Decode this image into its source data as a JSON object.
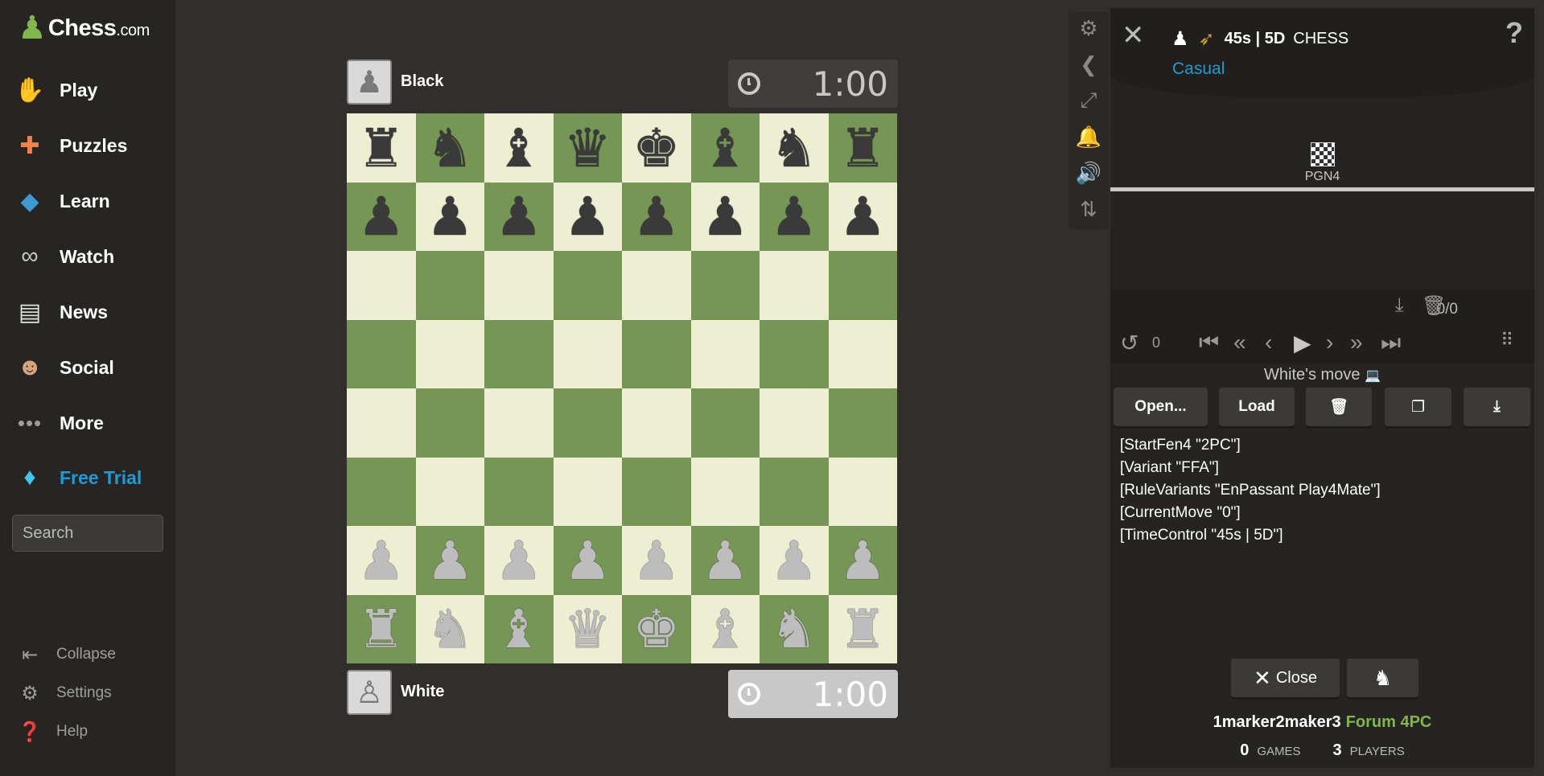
{
  "brand": {
    "word": "Chess",
    "suffix": ".com"
  },
  "sidebar": {
    "items": [
      {
        "label": "Play",
        "icon": "play-hand-icon"
      },
      {
        "label": "Puzzles",
        "icon": "puzzle-icon"
      },
      {
        "label": "Learn",
        "icon": "graduation-cap-icon"
      },
      {
        "label": "Watch",
        "icon": "binoculars-icon"
      },
      {
        "label": "News",
        "icon": "newspaper-icon"
      },
      {
        "label": "Social",
        "icon": "people-icon"
      },
      {
        "label": "More",
        "icon": "dots-icon"
      },
      {
        "label": "Free Trial",
        "icon": "diamond-icon"
      }
    ],
    "search_placeholder": "Search",
    "footer": [
      {
        "label": "Collapse",
        "icon": "collapse-icon"
      },
      {
        "label": "Settings",
        "icon": "gear-icon"
      },
      {
        "label": "Help",
        "icon": "help-icon"
      }
    ],
    "accent": "#1e9bd7"
  },
  "players": {
    "top": {
      "name": "Black",
      "clock": "1:00"
    },
    "bottom": {
      "name": "White",
      "clock": "1:00"
    }
  },
  "board": {
    "light_color": "#eeeed2",
    "dark_color": "#769656",
    "ranks": [
      [
        "bR",
        "bN",
        "bB",
        "bQ",
        "bK",
        "bB",
        "bN",
        "bR"
      ],
      [
        "bP",
        "bP",
        "bP",
        "bP",
        "bP",
        "bP",
        "bP",
        "bP"
      ],
      [
        "",
        "",
        "",
        "",
        "",
        "",
        "",
        ""
      ],
      [
        "",
        "",
        "",
        "",
        "",
        "",
        "",
        ""
      ],
      [
        "",
        "",
        "",
        "",
        "",
        "",
        "",
        ""
      ],
      [
        "",
        "",
        "",
        "",
        "",
        "",
        "",
        ""
      ],
      [
        "wP",
        "wP",
        "wP",
        "wP",
        "wP",
        "wP",
        "wP",
        "wP"
      ],
      [
        "wR",
        "wN",
        "wB",
        "wQ",
        "wK",
        "wB",
        "wN",
        "wR"
      ]
    ]
  },
  "panel": {
    "time_control": "45s | 5D",
    "variant_name": "CHESS",
    "rated": "Casual",
    "help": "?",
    "tab_label": "PGN4",
    "move_counter": "0/0",
    "undo_count": "0",
    "turn_text": "White's move",
    "buttons": {
      "open": "Open...",
      "load": "Load"
    },
    "pgn_lines": [
      "[StartFen4 \"2PC\"]",
      "[Variant \"FFA\"]",
      "[RuleVariants \"EnPassant Play4Mate\"]",
      "[CurrentMove \"0\"]",
      "[TimeControl \"45s | 5D\"]"
    ],
    "close_label": "Close",
    "username": "1marker2maker3",
    "forum_link": "Forum 4PC",
    "games_count": "0",
    "games_label": "GAMES",
    "players_count": "3",
    "players_label": "PLAYERS"
  }
}
